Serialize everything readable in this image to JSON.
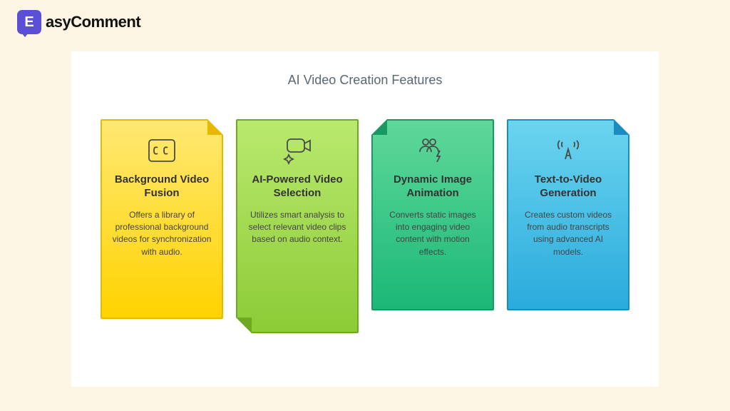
{
  "logo": {
    "letter": "E",
    "text": "asyComment"
  },
  "title": "AI Video Creation Features",
  "cards": [
    {
      "icon": "cc-icon",
      "heading": "Background Video Fusion",
      "body": "Offers a library of professional background videos for synchronization with audio."
    },
    {
      "icon": "video-sparkle-icon",
      "heading": "AI-Powered Video Selection",
      "body": "Utilizes smart analysis to select relevant video clips based on audio context."
    },
    {
      "icon": "people-bolt-icon",
      "heading": "Dynamic Image Animation",
      "body": "Converts static images into engaging video content with motion effects."
    },
    {
      "icon": "broadcast-a-icon",
      "heading": "Text-to-Video Generation",
      "body": "Creates custom videos from audio transcripts using advanced AI models."
    }
  ]
}
